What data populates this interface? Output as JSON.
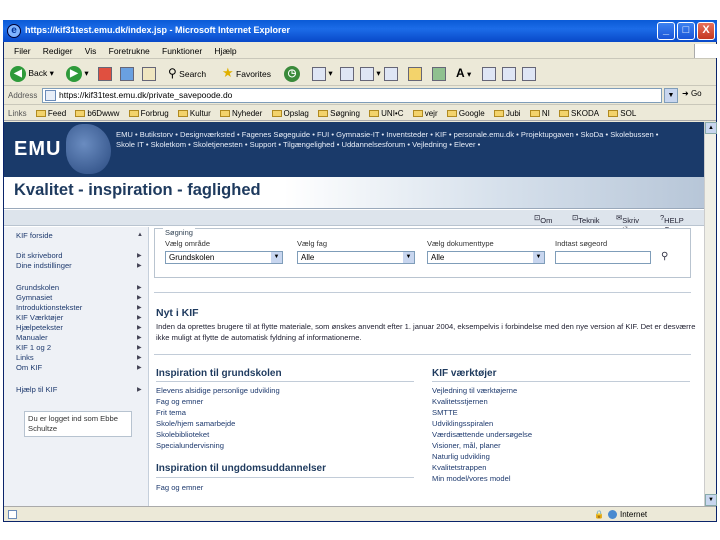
{
  "window": {
    "title": "https://kif31test.emu.dk/index.jsp - Microsoft Internet Explorer",
    "minimize": "_",
    "maximize": "□",
    "close": "X"
  },
  "menu": [
    "Filer",
    "Rediger",
    "Vis",
    "Foretrukne",
    "Funktioner",
    "Hjælp"
  ],
  "toolbar": {
    "back": "Back",
    "search": "Search",
    "favorites": "Favorites"
  },
  "address": {
    "label": "Address",
    "url": "https://kif31test.emu.dk/private_savepoode.do",
    "go": "Go"
  },
  "links": {
    "label": "Links",
    "items": [
      "Feed",
      "b6Dwww",
      "Forbrug",
      "Kultur",
      "Nyheder",
      "Opslag",
      "Søgning",
      "UNI•C",
      "vejr",
      "Google",
      "Jubi",
      "NI",
      "SKODA",
      "SOL"
    ]
  },
  "status": {
    "zone": "Internet"
  },
  "banner": {
    "logo_text": "EMU",
    "nav_line1": "EMU • Butikstorv • Designværksted • Fagenes Søgeguide • FUI • Gymnasie-IT • Inventsteder • KIF • personale.emu.dk • Projektupgaven • SkoDa • Skolebussen •",
    "nav_line2": "Skole IT • Skoletkom • Skoletjenesten • Support • Tilgængelighed • Uddannelsesforum • Vejledning • Elever •"
  },
  "page": {
    "title": "Kvalitet - inspiration - faglighed"
  },
  "topbar": {
    "om": "Om",
    "teknik": "Teknik",
    "skriv": "Skriv til",
    "help": "HELP C"
  },
  "leftnav": {
    "items": [
      "KIF forside",
      "Dit skrivebord",
      "Dine indstillinger",
      "Grundskolen",
      "Gymnasiet",
      "Introduktionstekster",
      "KIF Værktøjer",
      "Hjælpetekster",
      "Manualer",
      "KIF 1 og 2",
      "Links",
      "Om KIF",
      "Hjælp til KIF"
    ],
    "logged_in": "Du er logget ind som Ebbe Schultze"
  },
  "search": {
    "legend": "Søgning",
    "area_label": "Vælg område",
    "area_value": "Grundskolen",
    "subject_label": "Vælg fag",
    "subject_value": "Alle",
    "doctype_label": "Vælg dokumenttype",
    "doctype_value": "Alle",
    "keyword_label": "Indtast søgeord",
    "keyword_value": ""
  },
  "news": {
    "heading": "Nyt i KIF",
    "text": "Inden da oprettes brugere til at flytte materiale, som ønskes anvendt efter 1. januar 2004, eksempelvis i forbindelse med den nye version af KIF. Det er desværre ikke muligt at flytte de automatisk fyldning af informationerne."
  },
  "inspiration": {
    "heading": "Inspiration til grundskolen",
    "links": [
      "Elevens alsidige personlige udvikling",
      "Fag og emner",
      "Frit tema",
      "Skole/hjem samarbejde",
      "Skolebiblioteket",
      "Specialundervisning"
    ]
  },
  "tools": {
    "heading": "KIF værktøjer",
    "links": [
      "Vejledning til værktøjerne",
      "Kvalitetsstjernen",
      "SMTTE",
      "Udviklingsspiralen",
      "Værdisættende undersøgelse",
      "Visioner, mål, planer",
      "Naturlig udvikling",
      "Kvalitetstrappen",
      "Min model/vores model"
    ]
  },
  "youth": {
    "heading": "Inspiration til ungdomsuddannelser",
    "links": [
      "Fag og emner"
    ]
  }
}
